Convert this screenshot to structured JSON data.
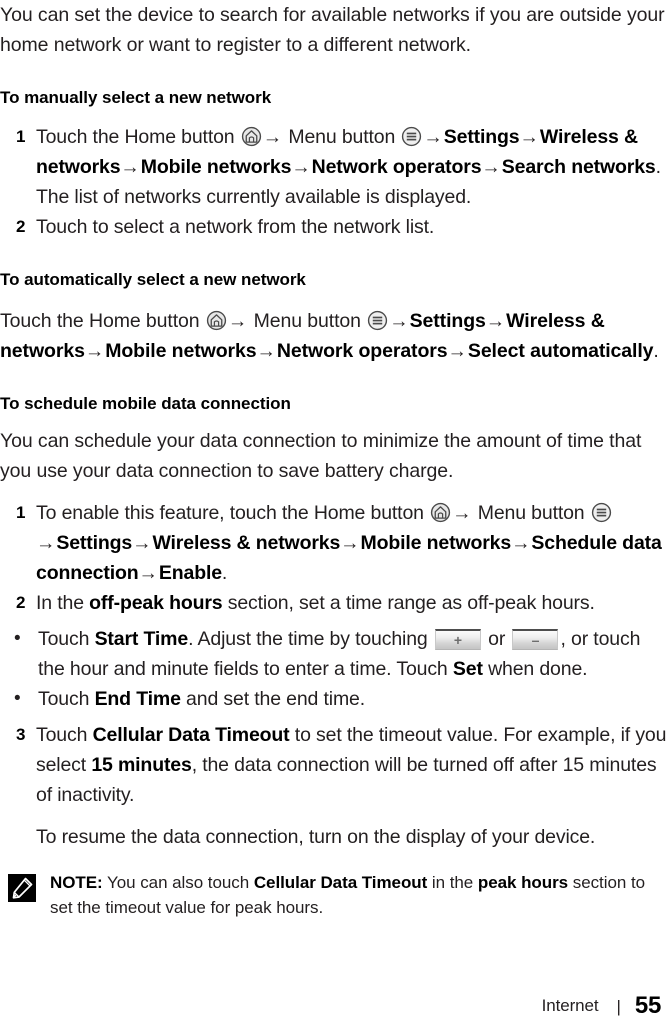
{
  "document": {
    "intro_paragraph": "You can set the device to search for available networks if you are outside your home network or want to register to a different network.",
    "footer": {
      "chapter": "Internet",
      "separator": "|",
      "page_number": "55"
    }
  },
  "icons": {
    "home": "home-button-icon",
    "menu": "menu-button-icon",
    "note": "note-pencil-icon",
    "plus_key": "plus-key-icon",
    "minus_key": "minus-key-icon",
    "arrow": "→"
  },
  "section_manual": {
    "heading": "To manually select a new network",
    "steps": [
      {
        "number": "1",
        "t1": "Touch the Home button ",
        "t2": " Menu button ",
        "b1": "Settings",
        "b2": "Wireless & networks",
        "b3": "Mobile networks",
        "b4": "Network operators",
        "b5": "Search networks",
        "t3": ". The list of networks currently available is displayed."
      },
      {
        "number": "2",
        "text": "Touch to select a network from the network list."
      }
    ]
  },
  "section_automatic": {
    "heading": "To automatically select a new network",
    "t1": "Touch the Home button ",
    "t2": " Menu button ",
    "b1": "Settings",
    "b2": "Wireless & networks",
    "b3": "Mobile networks",
    "b4": "Network operators",
    "b5": "Select automatically",
    "t3": "."
  },
  "section_schedule": {
    "heading": "To schedule mobile data connection",
    "intro": "You can schedule your data connection to minimize the amount of time that you use your data connection to save battery charge.",
    "step1": {
      "number": "1",
      "t1": "To enable this feature, touch the Home button ",
      "t2": " Menu button ",
      "b1": "Settings",
      "b2": "Wireless & networks",
      "b3": "Mobile networks",
      "b4": "Schedule data connection",
      "b5": "Enable",
      "t3": "."
    },
    "step2": {
      "number": "2",
      "t1": "In the ",
      "b1": "off-peak hours",
      "t2": " section, set a time range as off-peak hours.",
      "bullets": [
        {
          "t1": "Touch ",
          "b1": "Start Time",
          "t2": ". Adjust the time by touching ",
          "key_plus": "+",
          "t3": " or ",
          "key_minus": "–",
          "t4": ", or touch the hour and minute fields to enter a time. Touch ",
          "b2": "Set",
          "t5": " when done."
        },
        {
          "t1": "Touch ",
          "b1": "End Time",
          "t2": " and set the end time."
        }
      ]
    },
    "step3": {
      "number": "3",
      "t1": "Touch ",
      "b1": "Cellular Data Timeout",
      "t2": " to set the timeout value. For example, if you select ",
      "b2": "15 minutes",
      "t3": ", the data connection will be turned off after 15 minutes of inactivity.",
      "followup": "To resume the data connection, turn on the display of your device."
    }
  },
  "note": {
    "label": "NOTE:",
    "t1": " You can also touch ",
    "b1": "Cellular Data Timeout",
    "t2": " in the ",
    "b2": "peak hours",
    "t3": " section to set the timeout value for peak hours."
  }
}
